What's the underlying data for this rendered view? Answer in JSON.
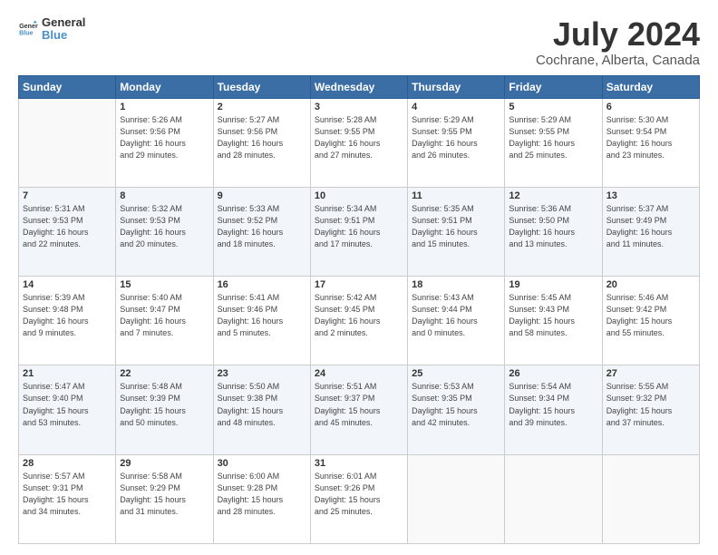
{
  "header": {
    "logo_line1": "General",
    "logo_line2": "Blue",
    "title": "July 2024",
    "subtitle": "Cochrane, Alberta, Canada"
  },
  "weekdays": [
    "Sunday",
    "Monday",
    "Tuesday",
    "Wednesday",
    "Thursday",
    "Friday",
    "Saturday"
  ],
  "weeks": [
    [
      {
        "num": "",
        "info": ""
      },
      {
        "num": "1",
        "info": "Sunrise: 5:26 AM\nSunset: 9:56 PM\nDaylight: 16 hours\nand 29 minutes."
      },
      {
        "num": "2",
        "info": "Sunrise: 5:27 AM\nSunset: 9:56 PM\nDaylight: 16 hours\nand 28 minutes."
      },
      {
        "num": "3",
        "info": "Sunrise: 5:28 AM\nSunset: 9:55 PM\nDaylight: 16 hours\nand 27 minutes."
      },
      {
        "num": "4",
        "info": "Sunrise: 5:29 AM\nSunset: 9:55 PM\nDaylight: 16 hours\nand 26 minutes."
      },
      {
        "num": "5",
        "info": "Sunrise: 5:29 AM\nSunset: 9:55 PM\nDaylight: 16 hours\nand 25 minutes."
      },
      {
        "num": "6",
        "info": "Sunrise: 5:30 AM\nSunset: 9:54 PM\nDaylight: 16 hours\nand 23 minutes."
      }
    ],
    [
      {
        "num": "7",
        "info": "Sunrise: 5:31 AM\nSunset: 9:53 PM\nDaylight: 16 hours\nand 22 minutes."
      },
      {
        "num": "8",
        "info": "Sunrise: 5:32 AM\nSunset: 9:53 PM\nDaylight: 16 hours\nand 20 minutes."
      },
      {
        "num": "9",
        "info": "Sunrise: 5:33 AM\nSunset: 9:52 PM\nDaylight: 16 hours\nand 18 minutes."
      },
      {
        "num": "10",
        "info": "Sunrise: 5:34 AM\nSunset: 9:51 PM\nDaylight: 16 hours\nand 17 minutes."
      },
      {
        "num": "11",
        "info": "Sunrise: 5:35 AM\nSunset: 9:51 PM\nDaylight: 16 hours\nand 15 minutes."
      },
      {
        "num": "12",
        "info": "Sunrise: 5:36 AM\nSunset: 9:50 PM\nDaylight: 16 hours\nand 13 minutes."
      },
      {
        "num": "13",
        "info": "Sunrise: 5:37 AM\nSunset: 9:49 PM\nDaylight: 16 hours\nand 11 minutes."
      }
    ],
    [
      {
        "num": "14",
        "info": "Sunrise: 5:39 AM\nSunset: 9:48 PM\nDaylight: 16 hours\nand 9 minutes."
      },
      {
        "num": "15",
        "info": "Sunrise: 5:40 AM\nSunset: 9:47 PM\nDaylight: 16 hours\nand 7 minutes."
      },
      {
        "num": "16",
        "info": "Sunrise: 5:41 AM\nSunset: 9:46 PM\nDaylight: 16 hours\nand 5 minutes."
      },
      {
        "num": "17",
        "info": "Sunrise: 5:42 AM\nSunset: 9:45 PM\nDaylight: 16 hours\nand 2 minutes."
      },
      {
        "num": "18",
        "info": "Sunrise: 5:43 AM\nSunset: 9:44 PM\nDaylight: 16 hours\nand 0 minutes."
      },
      {
        "num": "19",
        "info": "Sunrise: 5:45 AM\nSunset: 9:43 PM\nDaylight: 15 hours\nand 58 minutes."
      },
      {
        "num": "20",
        "info": "Sunrise: 5:46 AM\nSunset: 9:42 PM\nDaylight: 15 hours\nand 55 minutes."
      }
    ],
    [
      {
        "num": "21",
        "info": "Sunrise: 5:47 AM\nSunset: 9:40 PM\nDaylight: 15 hours\nand 53 minutes."
      },
      {
        "num": "22",
        "info": "Sunrise: 5:48 AM\nSunset: 9:39 PM\nDaylight: 15 hours\nand 50 minutes."
      },
      {
        "num": "23",
        "info": "Sunrise: 5:50 AM\nSunset: 9:38 PM\nDaylight: 15 hours\nand 48 minutes."
      },
      {
        "num": "24",
        "info": "Sunrise: 5:51 AM\nSunset: 9:37 PM\nDaylight: 15 hours\nand 45 minutes."
      },
      {
        "num": "25",
        "info": "Sunrise: 5:53 AM\nSunset: 9:35 PM\nDaylight: 15 hours\nand 42 minutes."
      },
      {
        "num": "26",
        "info": "Sunrise: 5:54 AM\nSunset: 9:34 PM\nDaylight: 15 hours\nand 39 minutes."
      },
      {
        "num": "27",
        "info": "Sunrise: 5:55 AM\nSunset: 9:32 PM\nDaylight: 15 hours\nand 37 minutes."
      }
    ],
    [
      {
        "num": "28",
        "info": "Sunrise: 5:57 AM\nSunset: 9:31 PM\nDaylight: 15 hours\nand 34 minutes."
      },
      {
        "num": "29",
        "info": "Sunrise: 5:58 AM\nSunset: 9:29 PM\nDaylight: 15 hours\nand 31 minutes."
      },
      {
        "num": "30",
        "info": "Sunrise: 6:00 AM\nSunset: 9:28 PM\nDaylight: 15 hours\nand 28 minutes."
      },
      {
        "num": "31",
        "info": "Sunrise: 6:01 AM\nSunset: 9:26 PM\nDaylight: 15 hours\nand 25 minutes."
      },
      {
        "num": "",
        "info": ""
      },
      {
        "num": "",
        "info": ""
      },
      {
        "num": "",
        "info": ""
      }
    ]
  ]
}
